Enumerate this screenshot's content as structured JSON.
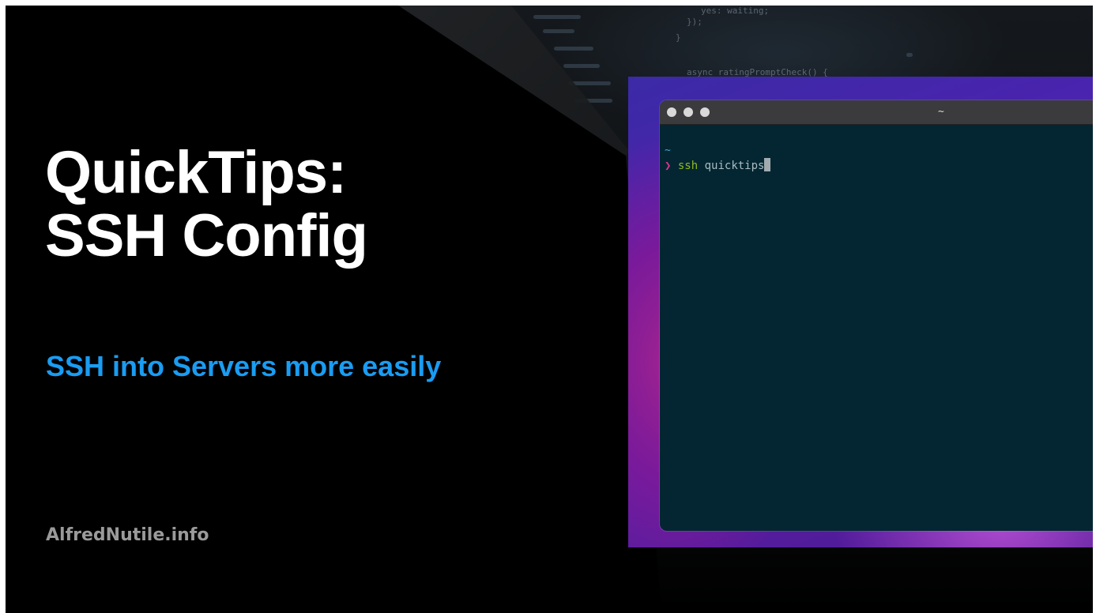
{
  "slide": {
    "title_line1": "QuickTips:",
    "title_line2": "SSH Config",
    "subtitle": "SSH into Servers more easily",
    "website": "AlfredNutile.info"
  },
  "background_code": {
    "lines": [
      "yes: waiting;",
      "});",
      "}",
      "async ratingPromptCheck() {"
    ]
  },
  "terminal": {
    "window_title": "~",
    "directory": "~",
    "prompt_symbol": "❯",
    "command": "ssh",
    "argument": "quicktips"
  },
  "colors": {
    "background": "#000000",
    "title": "#ffffff",
    "subtitle": "#1a9cf2",
    "website": "#9a9a9a",
    "terminal_bg": "#032632",
    "prompt": "#d6368f",
    "command": "#93b91e",
    "directory": "#3fa7d6"
  }
}
